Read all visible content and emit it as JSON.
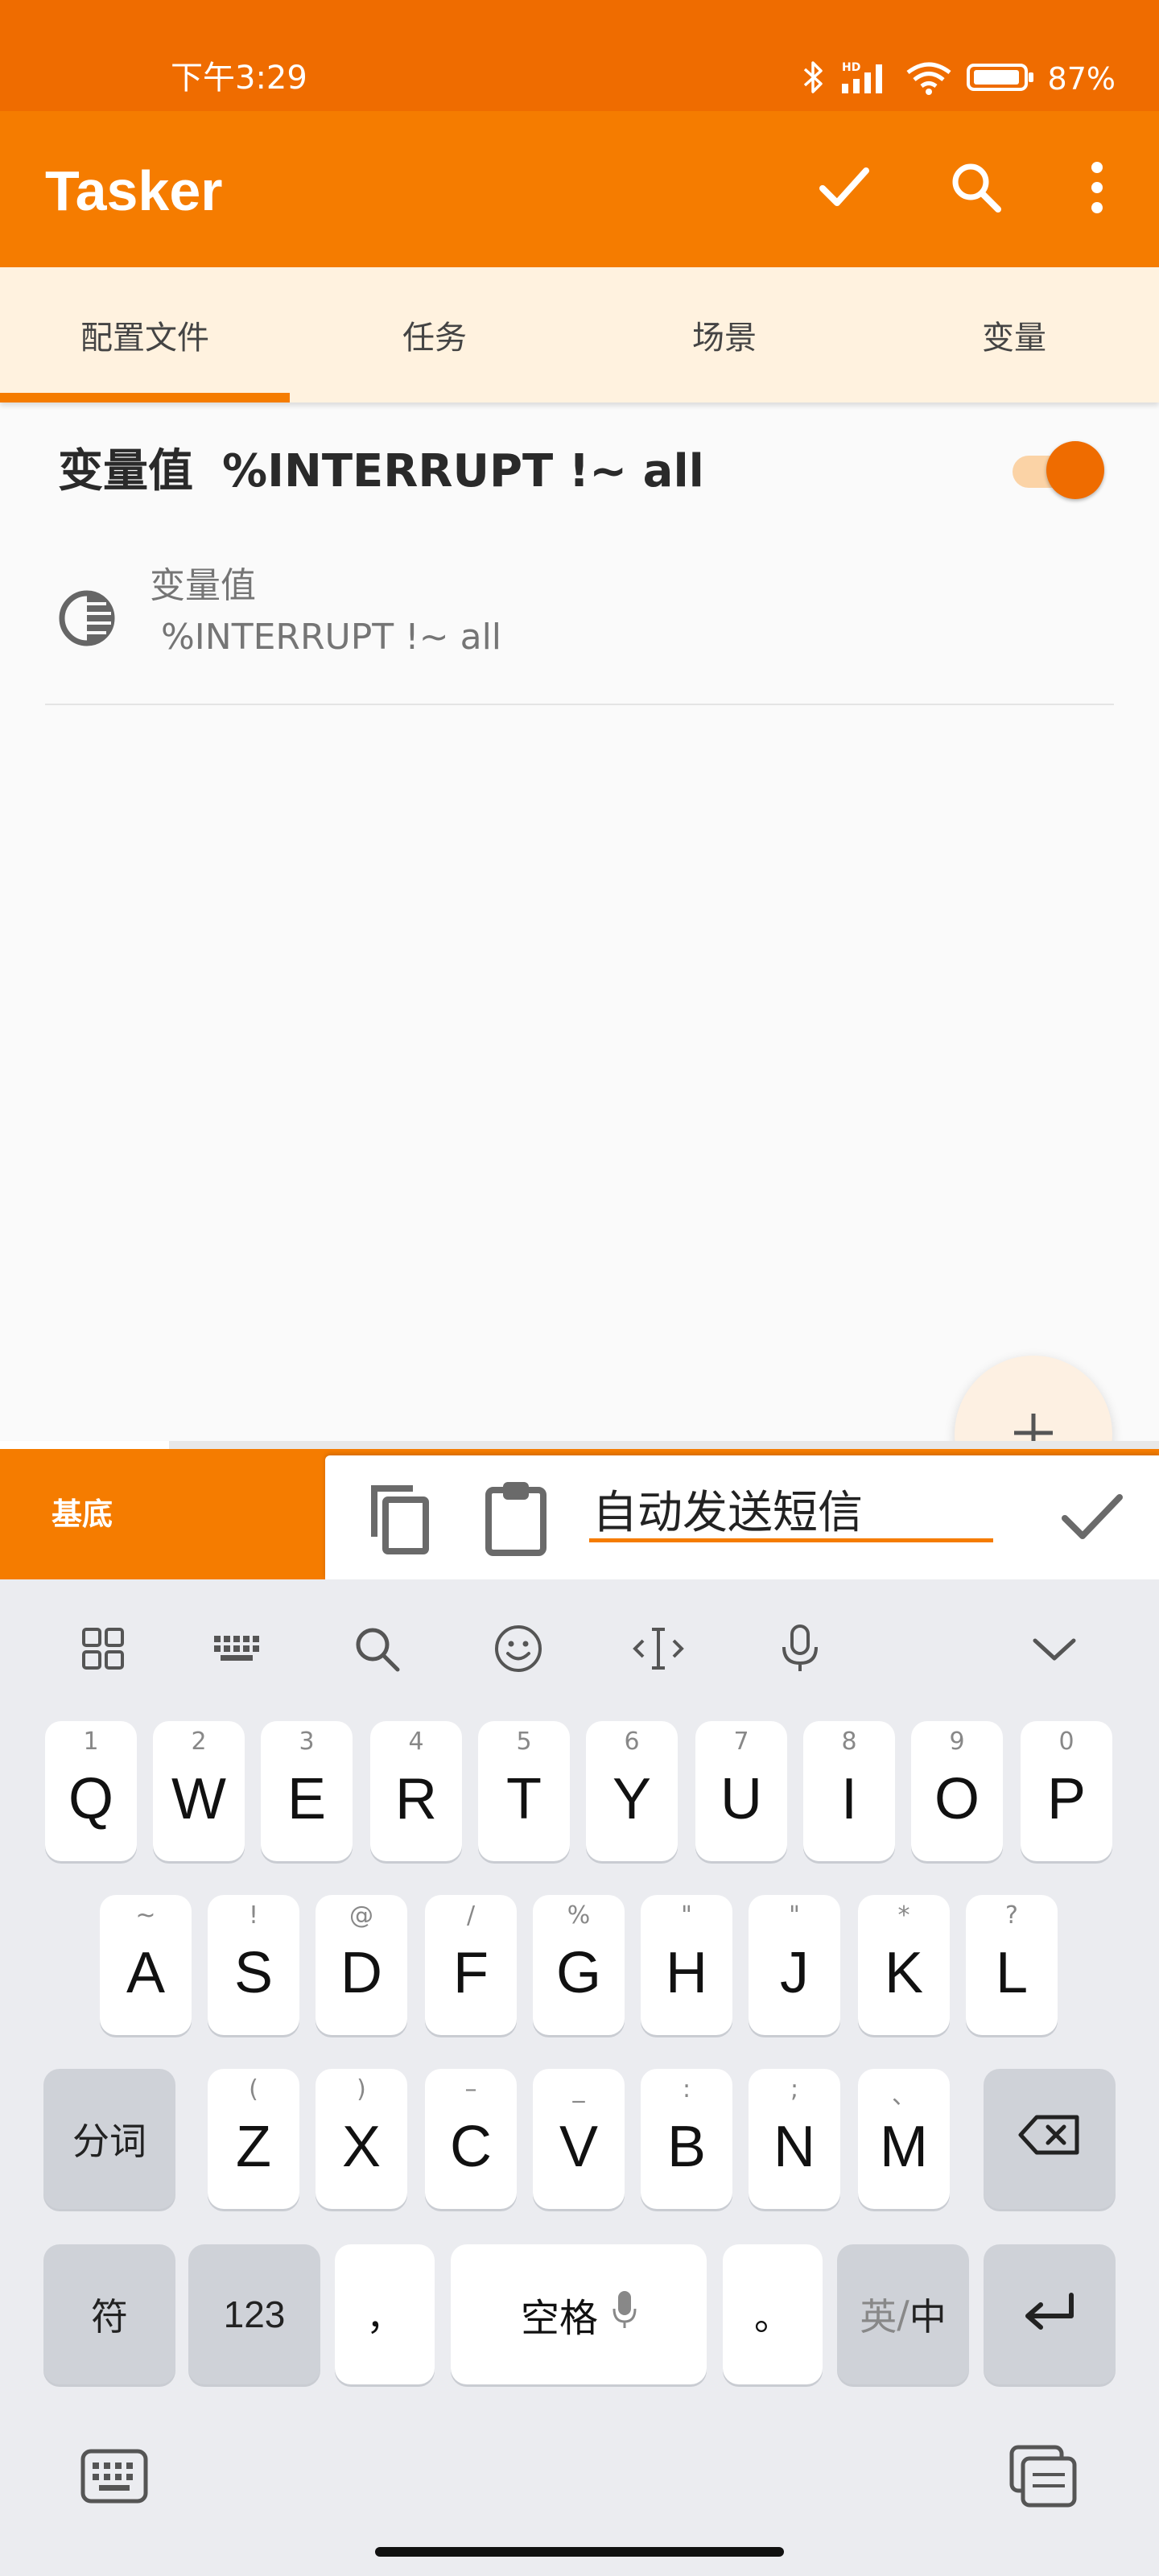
{
  "status_bar": {
    "time": "下午3:29",
    "battery": "87%"
  },
  "app_bar": {
    "title": "Tasker",
    "icons": [
      "check-icon",
      "search-icon",
      "more-vert-icon"
    ]
  },
  "tabs": [
    {
      "label": "配置文件",
      "active": true
    },
    {
      "label": "任务",
      "active": false
    },
    {
      "label": "场景",
      "active": false
    },
    {
      "label": "变量",
      "active": false
    }
  ],
  "profile": {
    "name": "变量值",
    "condition": "%INTERRUPT !~ all",
    "enabled": true,
    "context": {
      "label": "变量值",
      "value": "%INTERRUPT !~ all"
    }
  },
  "bottom_bar": {
    "base_label": "基底"
  },
  "name_bar": {
    "input_value": "自动发送短信"
  },
  "keyboard": {
    "row1": [
      {
        "hint": "1",
        "key": "Q"
      },
      {
        "hint": "2",
        "key": "W"
      },
      {
        "hint": "3",
        "key": "E"
      },
      {
        "hint": "4",
        "key": "R"
      },
      {
        "hint": "5",
        "key": "T"
      },
      {
        "hint": "6",
        "key": "Y"
      },
      {
        "hint": "7",
        "key": "U"
      },
      {
        "hint": "8",
        "key": "I"
      },
      {
        "hint": "9",
        "key": "O"
      },
      {
        "hint": "0",
        "key": "P"
      }
    ],
    "row2": [
      {
        "hint": "~",
        "key": "A"
      },
      {
        "hint": "!",
        "key": "S"
      },
      {
        "hint": "@",
        "key": "D"
      },
      {
        "hint": "/",
        "key": "F"
      },
      {
        "hint": "%",
        "key": "G"
      },
      {
        "hint": "\"",
        "key": "H"
      },
      {
        "hint": "\"",
        "key": "J"
      },
      {
        "hint": "*",
        "key": "K"
      },
      {
        "hint": "?",
        "key": "L"
      }
    ],
    "row3": [
      {
        "hint": "(",
        "key": "Z"
      },
      {
        "hint": ")",
        "key": "X"
      },
      {
        "hint": "–",
        "key": "C"
      },
      {
        "hint": "_",
        "key": "V"
      },
      {
        "hint": ":",
        "key": "B"
      },
      {
        "hint": ";",
        "key": "N"
      },
      {
        "hint": "、",
        "key": "M"
      }
    ],
    "segment_label": "分词",
    "symbols_label": "符",
    "numbers_label": "123",
    "comma_label": "，",
    "space_label": "空格",
    "period_label": "。",
    "lang_en": "英",
    "lang_sep": "/",
    "lang_zh": "中"
  }
}
